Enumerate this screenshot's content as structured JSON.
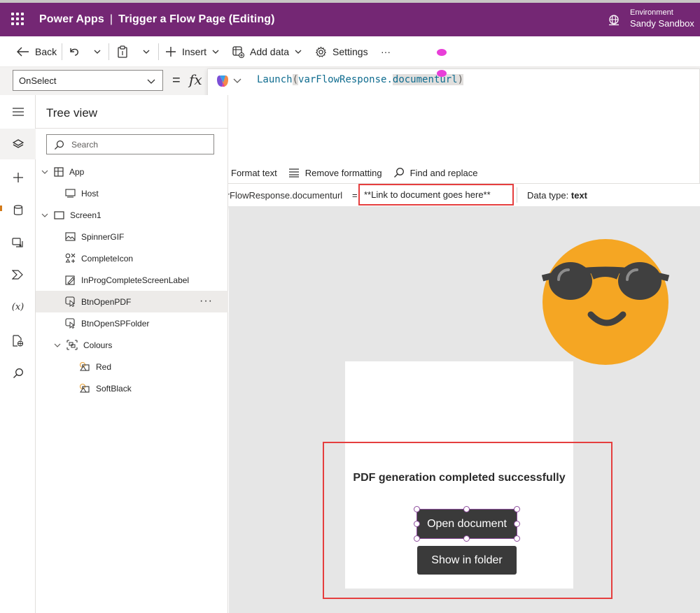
{
  "header": {
    "app_name": "Power Apps",
    "separator": "|",
    "page_title": "Trigger a Flow Page (Editing)",
    "environment_label": "Environment",
    "environment_name": "Sandy Sandbox",
    "bar_color": "#742774"
  },
  "commandbar": {
    "back": "Back",
    "insert": "Insert",
    "add_data": "Add data",
    "settings": "Settings",
    "more": "···"
  },
  "formula": {
    "property": "OnSelect",
    "equals": "=",
    "fx": "fx",
    "code_func": "Launch",
    "code_open": "(",
    "code_obj": "varFlowResponse",
    "code_dot": ".",
    "code_field": "documenturl",
    "code_close": ")",
    "tools": [
      "Format text",
      "Remove formatting",
      "Find and replace"
    ],
    "result_name": "varFlowResponse.documenturl",
    "result_eq": "=",
    "result_value": "**Link to document goes here**",
    "data_type_label": "Data type:",
    "data_type_value": "text"
  },
  "tree": {
    "title": "Tree view",
    "search_placeholder": "Search",
    "nodes": [
      {
        "label": "App"
      },
      {
        "label": "Host"
      },
      {
        "label": "Screen1"
      },
      {
        "label": "SpinnerGIF"
      },
      {
        "label": "CompleteIcon"
      },
      {
        "label": "InProgCompleteScreenLabel"
      },
      {
        "label": "BtnOpenPDF"
      },
      {
        "label": "BtnOpenSPFolder"
      },
      {
        "label": "Colours"
      },
      {
        "label": "Red"
      },
      {
        "label": "SoftBlack"
      }
    ],
    "more": "···"
  },
  "canvas": {
    "message": "PDF generation completed successfully",
    "open_button": "Open document",
    "folder_button": "Show in folder",
    "highlight_color": "#e53e3e",
    "emoji_color": "#f5a623"
  }
}
